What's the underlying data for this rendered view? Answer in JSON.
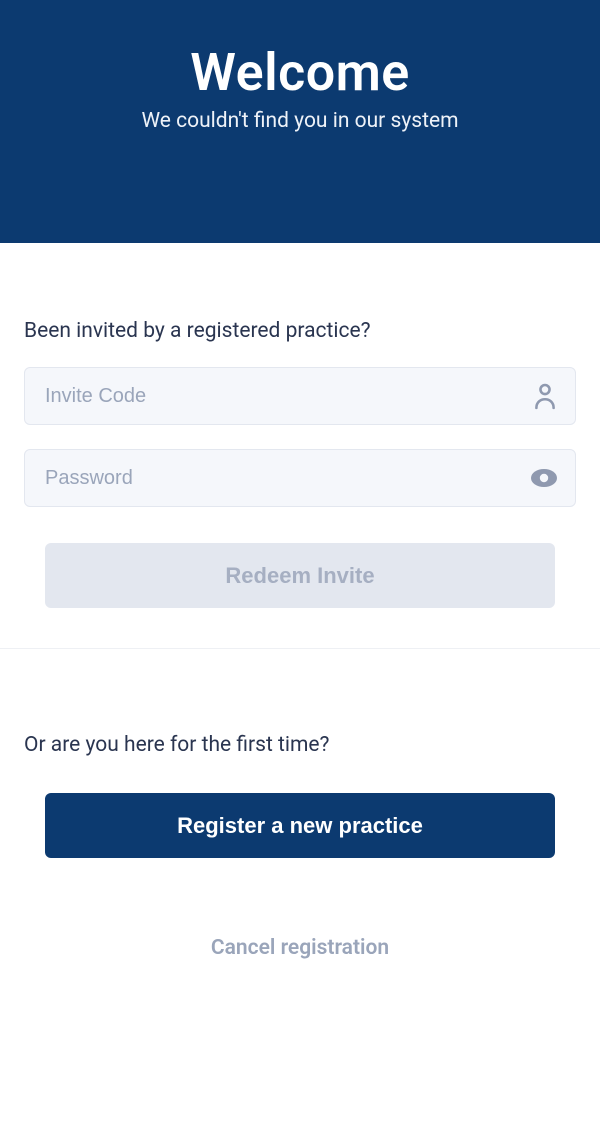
{
  "header": {
    "title": "Welcome",
    "subtitle": "We couldn't find you in our system"
  },
  "invite_section": {
    "prompt": "Been invited by a registered practice?",
    "invite_placeholder": "Invite Code",
    "password_placeholder": "Password",
    "redeem_label": "Redeem Invite"
  },
  "register_section": {
    "prompt": "Or are you here for the first time?",
    "register_label": "Register a new practice",
    "cancel_label": "Cancel registration"
  }
}
